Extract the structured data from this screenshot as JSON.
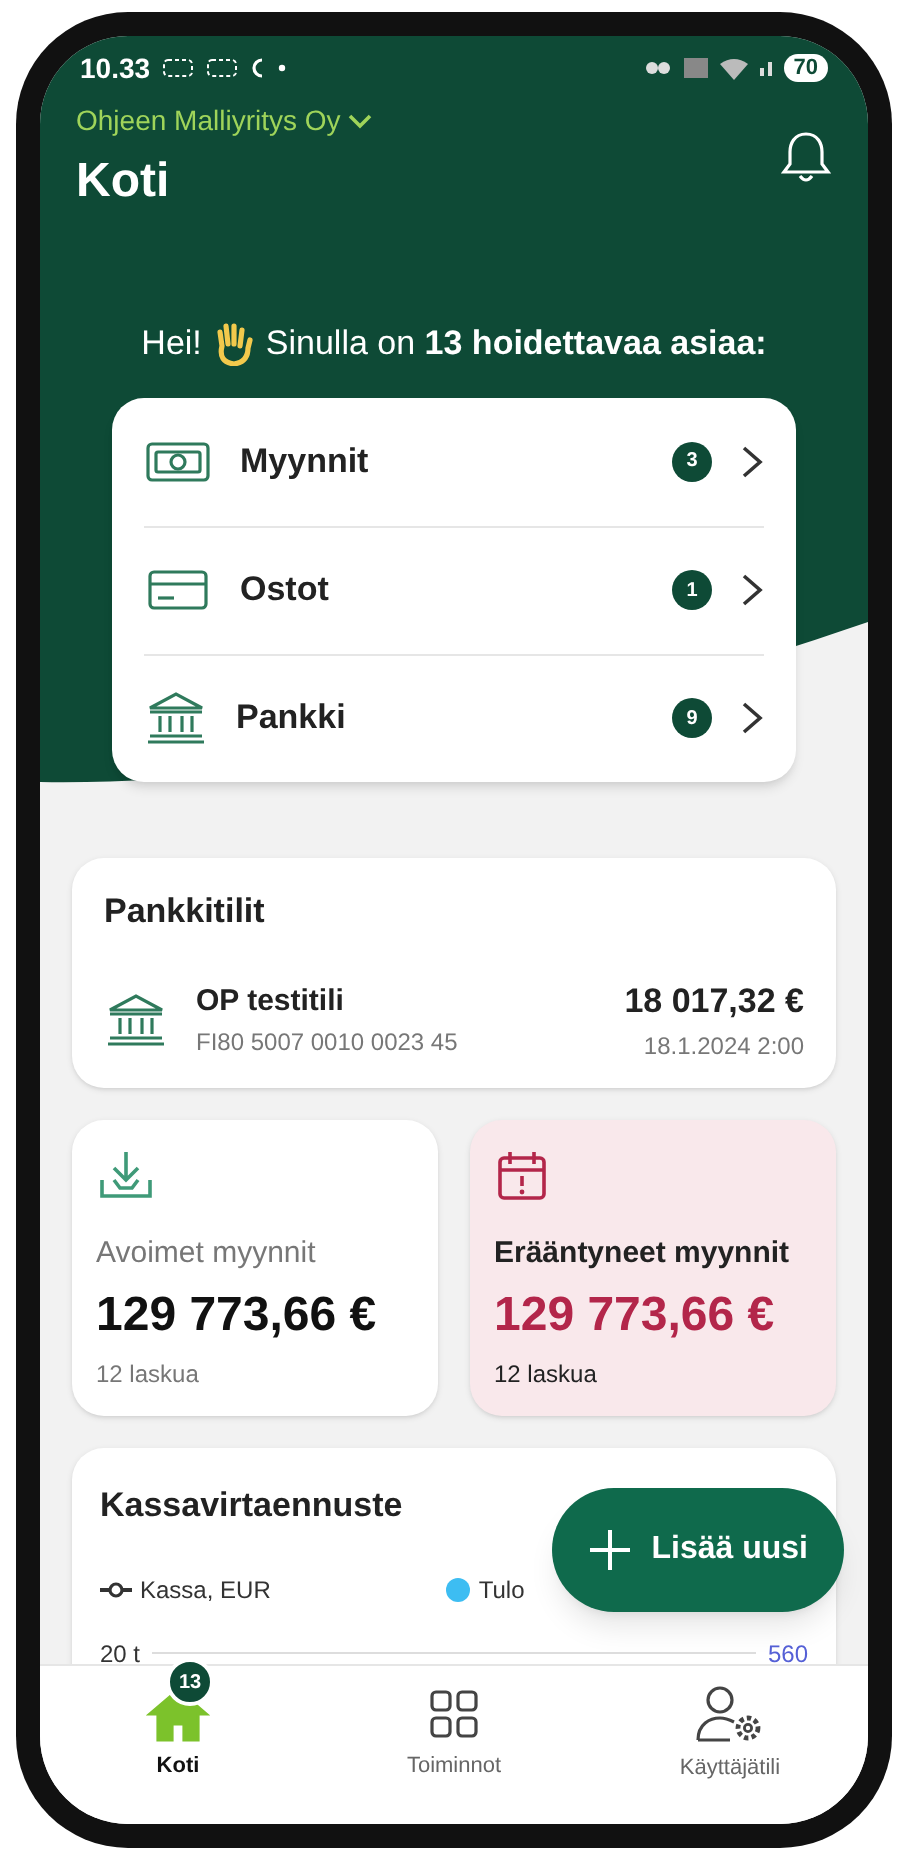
{
  "status_bar": {
    "time": "10.33",
    "battery": "70"
  },
  "header": {
    "company": "Ohjeen Malliyritys Oy",
    "title": "Koti"
  },
  "greeting": {
    "hello": "Hei!",
    "text": "Sinulla on **13 hoidettavaa asiaa:**"
  },
  "tasks": [
    {
      "kind": "sales",
      "label": "Myynnit",
      "count": "3"
    },
    {
      "kind": "purchases",
      "label": "Ostot",
      "count": "1"
    },
    {
      "kind": "bank",
      "label": "Pankki",
      "count": "9"
    }
  ],
  "bank_accounts": {
    "title": "Pankkitilit",
    "accounts": [
      {
        "name": "OP testitili",
        "iban": "FI80 5007 0010 0023 45",
        "balance": "18 017,32 €",
        "date": "18.1.2024 2:00"
      }
    ]
  },
  "tiles": [
    {
      "kind": "open",
      "label": "Avoimet myynnit",
      "amount": "129 773,66 €",
      "count": "12 laskua"
    },
    {
      "kind": "overdue",
      "label": "Erääntyneet myynnit",
      "amount": "129 773,66 €",
      "count": "12 laskua"
    }
  ],
  "cashflow": {
    "title": "Kassavirtaennuste",
    "legend": [
      {
        "kind": "line",
        "label": "Kassa, EUR"
      },
      {
        "kind": "dot",
        "label": "Tulo",
        "color": "#3dbdf2"
      }
    ],
    "left_tick": "20 t",
    "right_tick": "560"
  },
  "fab": {
    "label": "Lisää uusi"
  },
  "nav": [
    {
      "kind": "home",
      "label": "Koti",
      "selected": true,
      "badge": "13"
    },
    {
      "kind": "grid",
      "label": "Toiminnot",
      "selected": false
    },
    {
      "kind": "user",
      "label": "Käyttäjätili",
      "selected": false
    }
  ]
}
